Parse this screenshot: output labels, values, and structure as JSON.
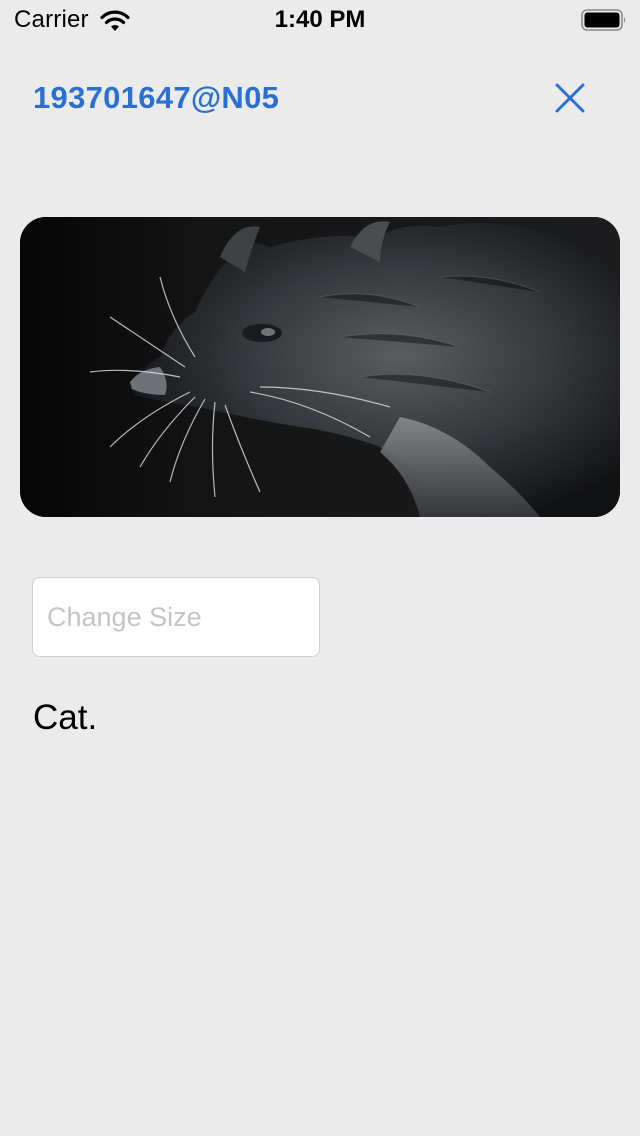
{
  "status_bar": {
    "carrier": "Carrier",
    "time": "1:40 PM",
    "wifi_icon": "wifi-icon",
    "battery_icon": "battery-full-icon"
  },
  "nav": {
    "title": "193701647@N05",
    "close_icon": "close-icon"
  },
  "photo": {
    "subject": "cat-photo"
  },
  "size_field": {
    "placeholder": "Change Size",
    "value": ""
  },
  "caption": "Cat.",
  "colors": {
    "accent": "#2a6fd4",
    "background": "#ebebeb"
  }
}
